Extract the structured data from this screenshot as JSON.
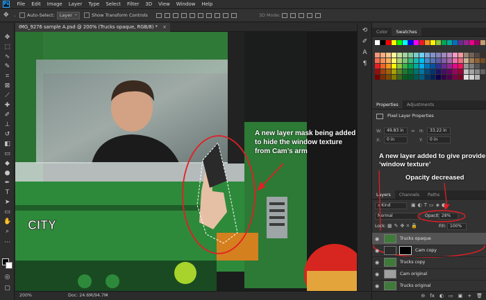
{
  "app": {
    "logo_text": "Ps"
  },
  "menu": [
    "File",
    "Edit",
    "Image",
    "Layer",
    "Type",
    "Select",
    "Filter",
    "3D",
    "View",
    "Window",
    "Help"
  ],
  "options_bar": {
    "auto_select_label": "Auto-Select:",
    "auto_select_value": "Layer",
    "show_transform_label": "Show Transform Controls",
    "mode_label": "3D Mode:"
  },
  "document": {
    "tab_title": "IMG_9276 sample A.psd @ 200% (Trucks opaque, RGB/8) *",
    "close_glyph": "×",
    "brand_text": "CITY"
  },
  "status": {
    "zoom": "200%",
    "doc_size": "Doc: 24.6M/94.7M",
    "arrow": "›"
  },
  "panels": {
    "color_tabs": [
      "Color",
      "Swatches"
    ],
    "swatch_colors": [
      [
        "#ffffff",
        "#000000",
        "#ff0000",
        "#ffff00",
        "#00ff00",
        "#00ffff",
        "#0000ff",
        "#ff00ff",
        "#ed1c24",
        "#f7941d",
        "#fff200",
        "#8dc63f",
        "#00a651",
        "#00a99d",
        "#0072bc",
        "#662d91",
        "#92278f",
        "#ec008c",
        "#9e005d",
        "#c69c6d"
      ],
      [
        "#f69679",
        "#f9ad81",
        "#fdc68a",
        "#fff79a",
        "#c4df9b",
        "#a2d39c",
        "#82ca9d",
        "#7bcdc8",
        "#6ecff6",
        "#7ea7d8",
        "#8393ca",
        "#8781bd",
        "#a187be",
        "#bc8cbf",
        "#f49ac2",
        "#f6989d",
        "#998675",
        "#736357",
        "#534741",
        "#37302a"
      ],
      [
        "#f26c4f",
        "#f68e56",
        "#fbaf5d",
        "#fff568",
        "#acd373",
        "#7cc576",
        "#3bb878",
        "#1abbb4",
        "#00bff3",
        "#438ccb",
        "#5574b9",
        "#605ca8",
        "#8560a8",
        "#a864a8",
        "#f06ea9",
        "#f26d7d",
        "#c7b299",
        "#a67c52",
        "#8c6239",
        "#754c24"
      ],
      [
        "#ed1c24",
        "#f26522",
        "#f7941d",
        "#fff200",
        "#8dc63f",
        "#39b54a",
        "#00a651",
        "#00a99d",
        "#00aeef",
        "#0072bc",
        "#0054a6",
        "#2e3192",
        "#662d91",
        "#92278f",
        "#ec008c",
        "#ed145b",
        "#959595",
        "#7d7d7d",
        "#555555",
        "#363636"
      ],
      [
        "#9e0b0f",
        "#a0410d",
        "#a3620a",
        "#aba000",
        "#598527",
        "#1a7b30",
        "#007236",
        "#00746b",
        "#0076a3",
        "#004b80",
        "#003471",
        "#1b1464",
        "#440e62",
        "#630460",
        "#9e005d",
        "#9e0039",
        "#c2c2c2",
        "#a4a4a4",
        "#898989",
        "#636363"
      ],
      [
        "#790000",
        "#7b2e00",
        "#7d4900",
        "#827b00",
        "#406618",
        "#005e20",
        "#005826",
        "#005952",
        "#005b7f",
        "#003663",
        "#002157",
        "#0d004c",
        "#32004b",
        "#4b0049",
        "#7b0046",
        "#7a0026",
        "#e1e1e1",
        "#d2d2d2",
        "#b4b4b4",
        "#2d2d2d"
      ]
    ],
    "properties_tabs": [
      "Properties",
      "Adjustments"
    ],
    "properties_title": "Pixel Layer Properties",
    "w_label": "W:",
    "w_value": "49.83 in",
    "h_label": "H:",
    "h_value": "33.22 in",
    "x_label": "X:",
    "x_value": "0 in",
    "y_label": "Y:",
    "y_value": "0 in",
    "layers_tabs": [
      "Layers",
      "Channels",
      "Paths"
    ],
    "kind_label": "Kind",
    "blend_mode": "Normal",
    "opacity_label": "Opacity:",
    "opacity_value": "28%",
    "lock_label": "Lock:",
    "fill_label": "Fill:",
    "fill_value": "100%",
    "layers": [
      {
        "name": "Trucks opaque",
        "selected": true,
        "mask": false
      },
      {
        "name": "Cam copy",
        "selected": false,
        "mask": true
      },
      {
        "name": "Trucks copy",
        "selected": false,
        "mask": false
      },
      {
        "name": "Cam original",
        "selected": false,
        "mask": false
      },
      {
        "name": "Trucks original",
        "selected": false,
        "mask": false
      }
    ],
    "footer_icons": [
      "⊖",
      "fx",
      "◐",
      "▭",
      "▣",
      "+",
      "🗑"
    ]
  },
  "annotations": {
    "mask_note": "A new layer mask being added to hide the window texture from Cam’s arm",
    "layer_note": "A new layer added to give provide ‘window texture’",
    "opacity_note": "Opacity decreased"
  }
}
